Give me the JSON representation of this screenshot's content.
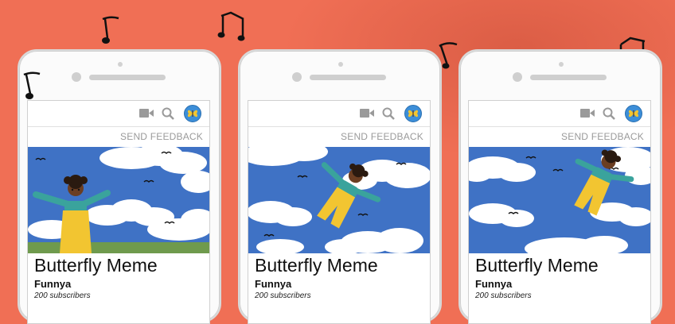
{
  "feedback_label": "SEND FEEDBACK",
  "video_title": "Butterfly Meme",
  "channel_name": "Funnya",
  "subscriber_count": "200 subscribers",
  "colors": {
    "background": "#f06f55",
    "sky": "#3f72c5",
    "overalls": "#f2c531",
    "shirt": "#3aa39c",
    "grass": "#6f9a4d",
    "avatar": "#3c8ed8"
  },
  "icons": [
    "video-camera-icon",
    "search-icon",
    "butterfly-avatar-icon",
    "music-note-icon"
  ]
}
